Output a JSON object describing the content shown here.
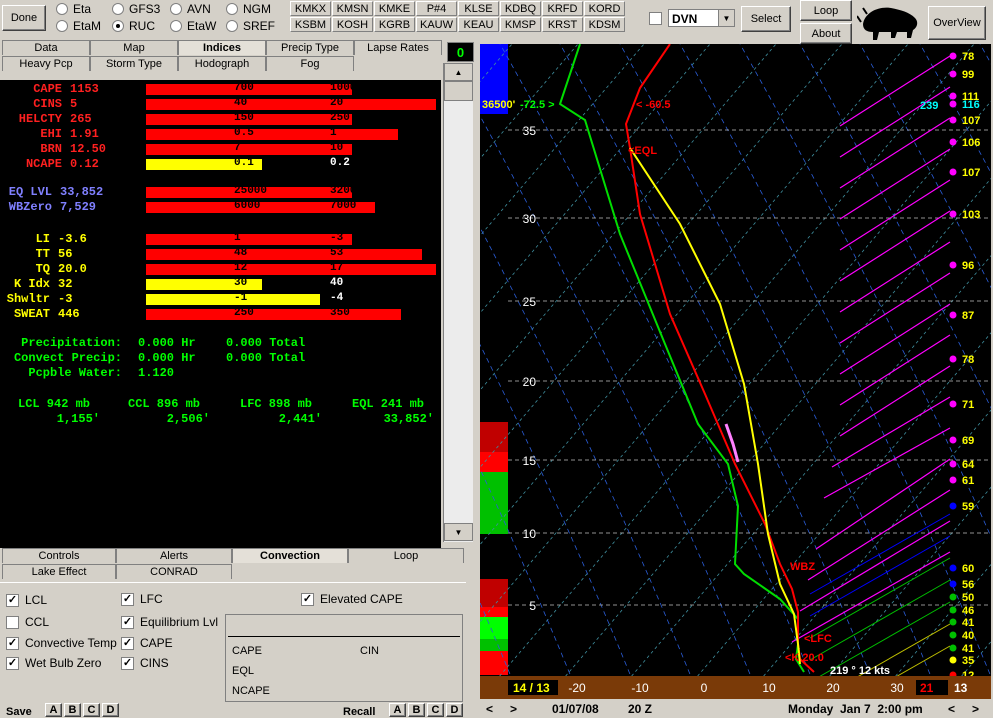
{
  "toolbar": {
    "done": "Done",
    "models": [
      {
        "label": "Eta",
        "selected": false
      },
      {
        "label": "GFS3",
        "selected": false
      },
      {
        "label": "AVN",
        "selected": false
      },
      {
        "label": "NGM",
        "selected": false
      },
      {
        "label": "EtaM",
        "selected": false
      },
      {
        "label": "RUC",
        "selected": true
      },
      {
        "label": "EtaW",
        "selected": false
      },
      {
        "label": "SREF",
        "selected": false
      }
    ],
    "stations_row1": [
      "KMKX",
      "KMSN",
      "KMKE",
      "P#4",
      "KLSE",
      "KDBQ",
      "KRFD",
      "KORD"
    ],
    "stations_row2": [
      "KSBM",
      "KOSH",
      "KGRB",
      "KAUW",
      "KEAU",
      "KMSP",
      "KRST",
      "KDSM"
    ],
    "station_select": "DVN",
    "select_btn": "Select",
    "loop_btn": "Loop",
    "about_btn": "About",
    "overview_btn": "OverView"
  },
  "tabs_top": [
    "Data",
    "Map",
    "Indices",
    "Precip Type",
    "Lapse Rates"
  ],
  "tabs_second": [
    "Heavy Pcp",
    "Storm Type",
    "Hodograph",
    "Fog"
  ],
  "counter": "0",
  "indices": [
    {
      "label": "CAPE",
      "value": "1153",
      "bar_color": "#ff0000",
      "bar_frac": 0.71,
      "n1": "700",
      "n2": "1000"
    },
    {
      "label": "CINS",
      "value": "5",
      "bar_color": "#ff0000",
      "bar_frac": 1.0,
      "n1": "40",
      "n2": "20"
    },
    {
      "label": "HELCTY",
      "value": "265",
      "bar_color": "#ff0000",
      "bar_frac": 0.71,
      "n1": "150",
      "n2": "250"
    },
    {
      "label": "EHI",
      "value": "1.91",
      "bar_color": "#ff0000",
      "bar_frac": 0.87,
      "n1": "0.5",
      "n2": "1"
    },
    {
      "label": "BRN",
      "value": "12.50",
      "bar_color": "#ff0000",
      "bar_frac": 0.71,
      "n1": "7",
      "n2": "10"
    },
    {
      "label": "NCAPE",
      "value": "0.12",
      "bar_color": "#ffff00",
      "bar_frac": 0.4,
      "n1": "0.1",
      "n2": "0.2"
    }
  ],
  "levels": [
    {
      "label": "EQ LVL",
      "value": "33,852",
      "bar_color": "#ff0000",
      "bar_frac": 0.71,
      "n1": "25000",
      "n2": "32000"
    },
    {
      "label": "WBZero",
      "value": "7,529",
      "bar_color": "#ff0000",
      "bar_frac": 0.79,
      "n1": "6000",
      "n2": "7000"
    }
  ],
  "stability": [
    {
      "label": "LI",
      "value": "-3.6",
      "bar_color": "#ff0000",
      "bar_frac": 0.71,
      "n1": "1",
      "n2": "-3"
    },
    {
      "label": "TT",
      "value": "56",
      "bar_color": "#ff0000",
      "bar_frac": 0.95,
      "n1": "48",
      "n2": "53"
    },
    {
      "label": "TQ",
      "value": "20.0",
      "bar_color": "#ff0000",
      "bar_frac": 1.0,
      "n1": "12",
      "n2": "17"
    },
    {
      "label": "K Idx",
      "value": "32",
      "bar_color": "#ffff00",
      "bar_frac": 0.4,
      "n1": "30",
      "n2": "40"
    },
    {
      "label": "Shwltr",
      "value": "-3",
      "bar_color": "#ffff00",
      "bar_frac": 0.6,
      "n1": "-1",
      "n2": "-4"
    },
    {
      "label": "SWEAT",
      "value": "446",
      "bar_color": "#ff0000",
      "bar_frac": 0.88,
      "n1": "250",
      "n2": "350"
    }
  ],
  "precip": [
    {
      "label": "Precipitation:",
      "v1": "0.000 Hr",
      "v2": "0.000 Total"
    },
    {
      "label": "Convect Precip:",
      "v1": "0.000 Hr",
      "v2": "0.000 Total"
    },
    {
      "label": "Pcpble Water:",
      "v1": "1.120",
      "v2": ""
    }
  ],
  "lev_row": [
    {
      "title": "LCL 942 mb",
      "val": "1,155'"
    },
    {
      "title": "CCL 896 mb",
      "val": "2,506'"
    },
    {
      "title": "LFC 898 mb",
      "val": "2,441'"
    },
    {
      "title": "EQL 241 mb",
      "val": "33,852'"
    }
  ],
  "tabs_bottom1": [
    "Controls",
    "Alerts",
    "Convection",
    "Loop"
  ],
  "tabs_bottom2": [
    "Lake Effect",
    "CONRAD"
  ],
  "checks": [
    {
      "label": "LCL",
      "checked": true
    },
    {
      "label": "CCL",
      "checked": false
    },
    {
      "label": "Convective Temp",
      "checked": true
    },
    {
      "label": "Wet Bulb Zero",
      "checked": true
    },
    {
      "label": "LFC",
      "checked": true
    },
    {
      "label": "Equilibrium Lvl",
      "checked": true
    },
    {
      "label": "CAPE",
      "checked": true
    },
    {
      "label": "CINS",
      "checked": true
    },
    {
      "label": "Elevated CAPE",
      "checked": true
    }
  ],
  "box_labels": {
    "cape": "CAPE",
    "cin": "CIN",
    "eql": "EQL",
    "ncape": "NCAPE"
  },
  "footer": {
    "save": "Save",
    "recall": "Recall",
    "slots": [
      "A",
      "B",
      "C",
      "D"
    ]
  },
  "skewt": {
    "y_labels": [
      "35",
      "30",
      "25",
      "20",
      "15",
      "10",
      "5"
    ],
    "x_labels": [
      "-20",
      "-10",
      "0",
      "10",
      "20",
      "30"
    ],
    "left_box": "14 / 13",
    "right_box": "21",
    "right_box2": "13",
    "top_readout": "36500'",
    "top_temp": "-72.5 >",
    "top_dew": "< -60.5",
    "eql": "<EQL",
    "wbz": "WBZ",
    "lfc": "<LFC",
    "sfc": "<K 20.0",
    "wind": "219 ° 12 kts",
    "right_speed": "239",
    "speeds": [
      "78",
      "99",
      "111",
      "116",
      "107",
      "106",
      "107",
      "103",
      "96",
      "87",
      "78",
      "71",
      "69",
      "64",
      "61",
      "59",
      "60",
      "56",
      "50",
      "46",
      "41",
      "40",
      "41",
      "35",
      "12"
    ]
  },
  "status": {
    "date": "01/07/08",
    "time": "20 Z",
    "local": "Monday  Jan 7  2:00 pm"
  }
}
